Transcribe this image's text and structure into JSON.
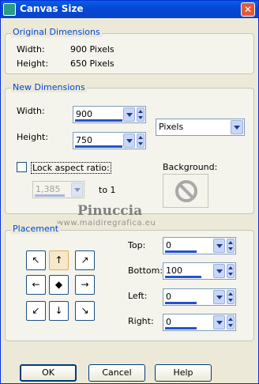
{
  "window": {
    "title": "Canvas Size",
    "close_glyph": "✕"
  },
  "original": {
    "group_title": "Original Dimensions",
    "width_label": "Width:",
    "width_value": "900 Pixels",
    "height_label": "Height:",
    "height_value": "650 Pixels"
  },
  "new_dims": {
    "group_title": "New Dimensions",
    "width_label": "Width:",
    "width_value": "900",
    "height_label": "Height:",
    "height_value": "750",
    "units": "Pixels",
    "lock_label": "Lock aspect ratio:",
    "lock_checked": false,
    "ratio_value": "1,385",
    "ratio_suffix": "to 1",
    "background_label": "Background:"
  },
  "watermark": {
    "name": "Pinuccia",
    "site": "www.maidiregrafica.eu"
  },
  "placement": {
    "group_title": "Placement",
    "top_label": "Top:",
    "top_value": "0",
    "bottom_label": "Bottom:",
    "bottom_value": "100",
    "left_label": "Left:",
    "left_value": "0",
    "right_label": "Right:",
    "right_value": "0",
    "anchor_glyphs": [
      "↖",
      "↑",
      "↗",
      "←",
      "◆",
      "→",
      "↙",
      "↓",
      "↘"
    ],
    "selected_anchor": "top-center"
  },
  "buttons": {
    "ok": "OK",
    "cancel": "Cancel",
    "help": "Help"
  }
}
